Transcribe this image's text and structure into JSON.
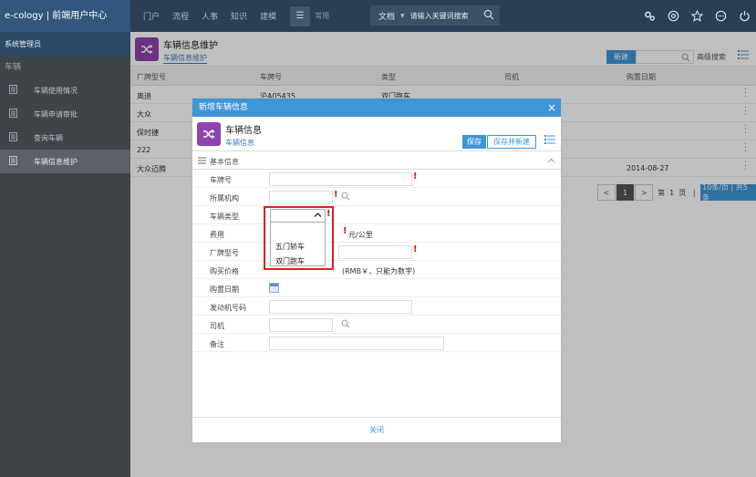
{
  "brand": "e-cology | 前端用户中心",
  "nav": {
    "items": [
      "门户",
      "流程",
      "人事",
      "知识",
      "建模"
    ],
    "common": "常用"
  },
  "search": {
    "scope": "文档",
    "placeholder": "请输入关键词搜索"
  },
  "sidebar": {
    "header": "系统管理员",
    "group": "车辆",
    "items": [
      {
        "label": "车辆使用情况"
      },
      {
        "label": "车辆申请审批"
      },
      {
        "label": "查询车辆"
      },
      {
        "label": "车辆信息维护"
      }
    ]
  },
  "main": {
    "title": "车辆信息维护",
    "subtitle": "车辆信息维护",
    "new_button": "新建",
    "advanced_search": "高级搜索",
    "columns": [
      "厂牌型号",
      "车牌号",
      "类型",
      "司机",
      "购置日期"
    ],
    "rows": [
      [
        "奥迪",
        "沪A05435",
        "双门跑车",
        "",
        ""
      ],
      [
        "大众",
        "",
        "",
        "",
        ""
      ],
      [
        "保时捷",
        "",
        "",
        "",
        ""
      ],
      [
        "222",
        "",
        "",
        "",
        ""
      ],
      [
        "大众迈腾",
        "",
        "",
        "",
        "2014-08-27"
      ]
    ],
    "pager": {
      "prev": "<",
      "current": "1",
      "next": ">",
      "page_prefix": "第",
      "page_num": "1",
      "page_suffix": "页",
      "page_size": "10条/页 | 共5条"
    }
  },
  "dialog": {
    "title": "新增车辆信息",
    "close": "×",
    "header_title": "车辆信息",
    "header_sub": "车辆信息",
    "save": "保存",
    "save_new": "保存并新建",
    "section": "基本信息",
    "fields": {
      "plate": "车牌号",
      "org": "所属机构",
      "type": "车辆类型",
      "cost": "费用",
      "cost_unit": "元/公里",
      "model": "厂牌型号",
      "price": "购买价格",
      "price_note": "(RMB￥，只能为数字)",
      "date": "购置日期",
      "engine": "发动机号码",
      "driver": "司机",
      "remark": "备注"
    },
    "dropdown_options": [
      "五门轿车",
      "双门跑车"
    ],
    "footer": "关闭"
  }
}
